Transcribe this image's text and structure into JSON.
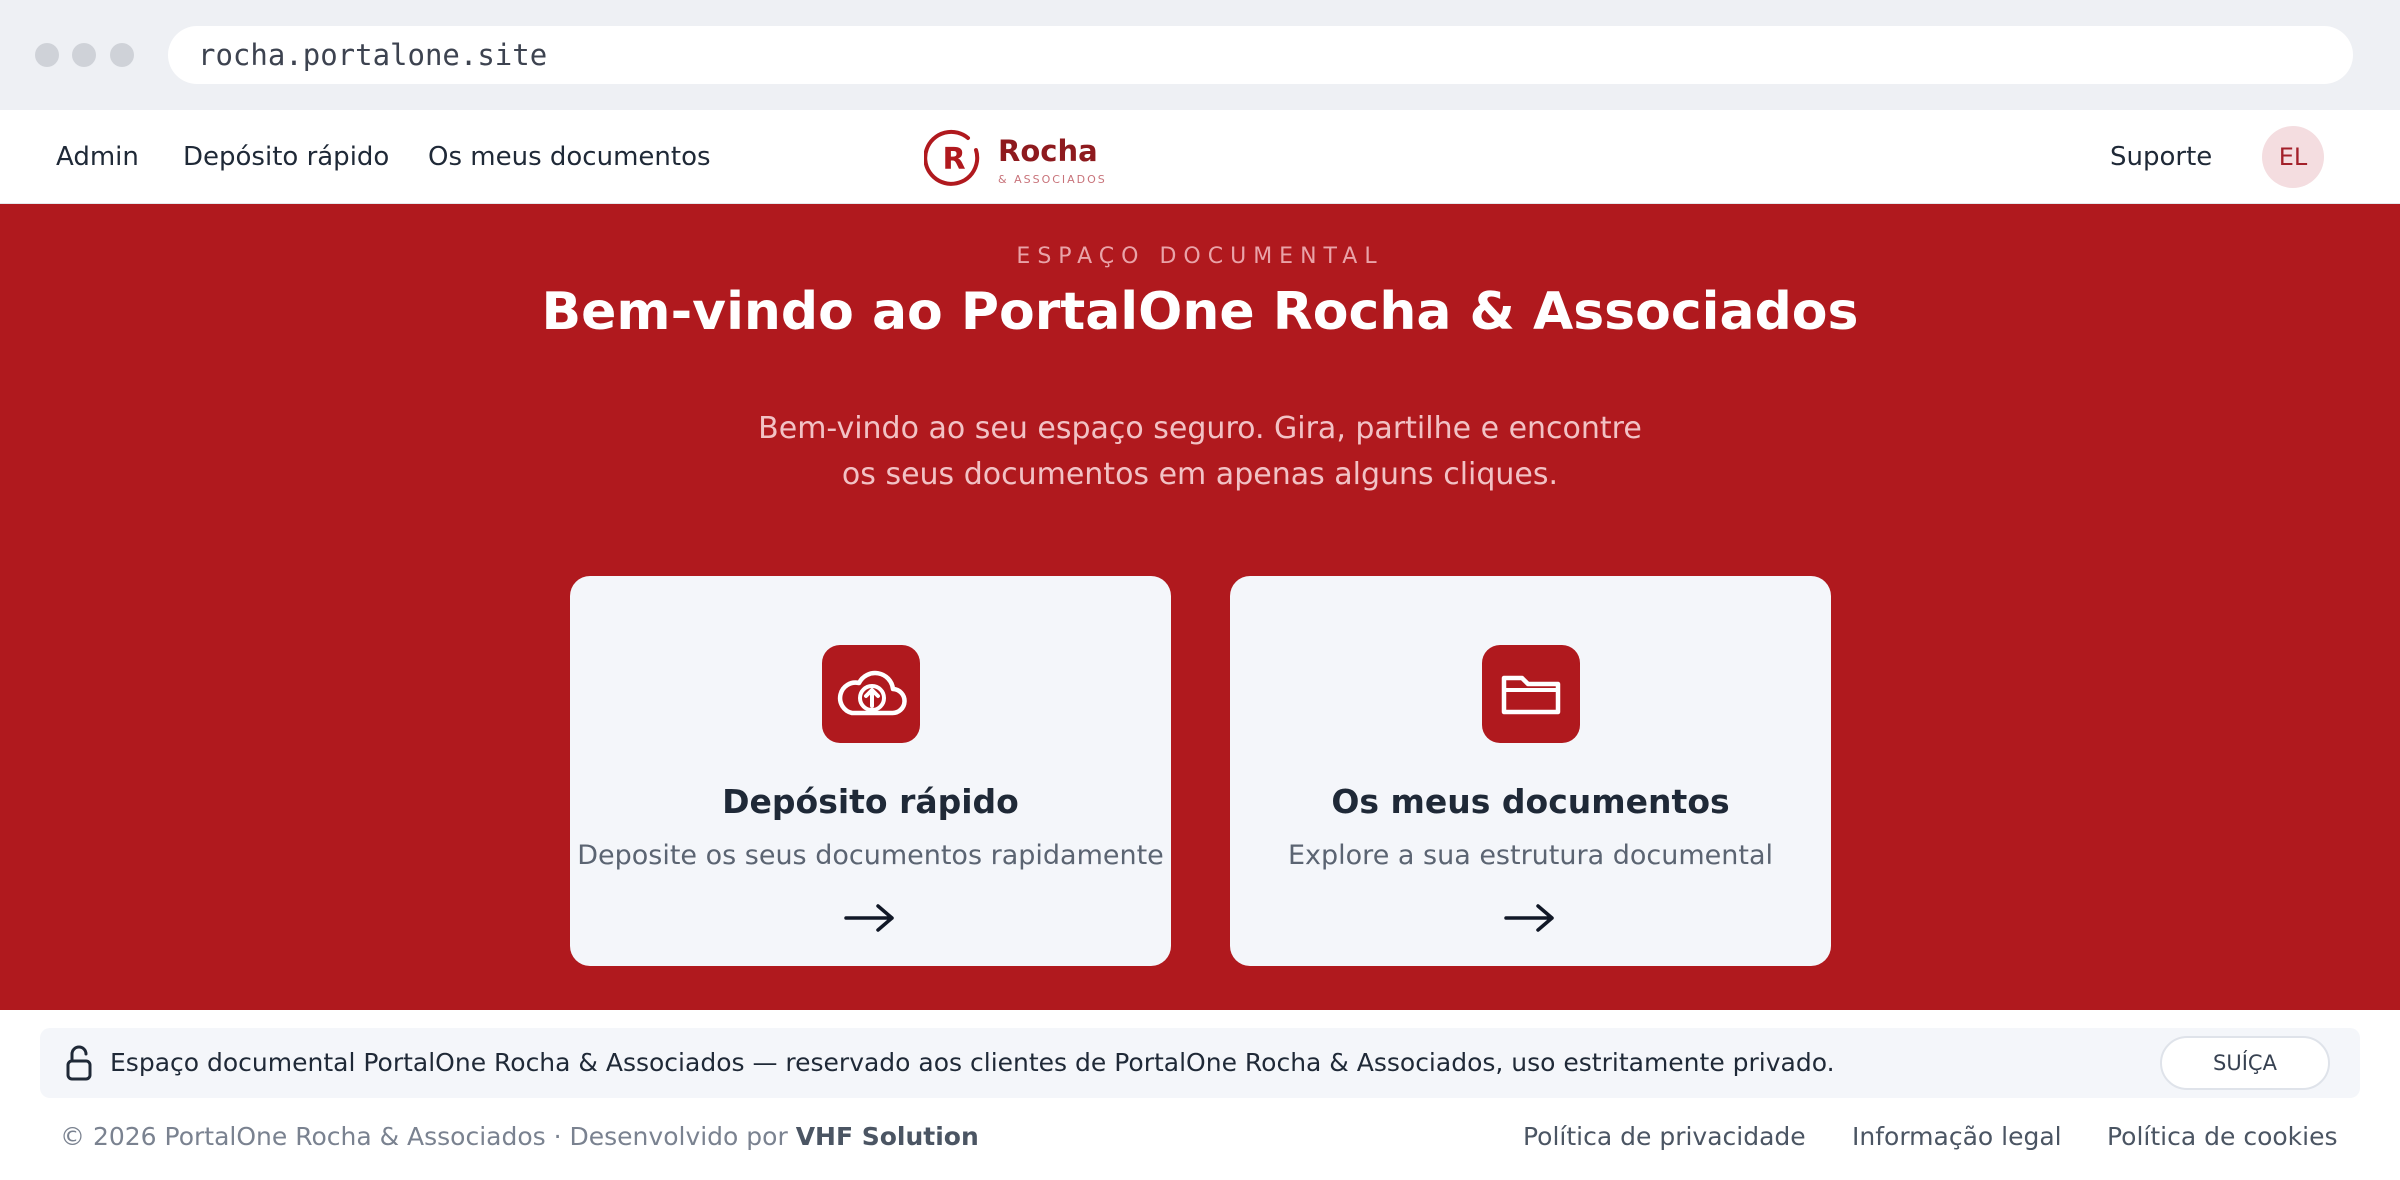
{
  "browser": {
    "url": "rocha.portalone.site"
  },
  "nav": {
    "links": [
      "Admin",
      "Depósito rápido",
      "Os meus documentos"
    ],
    "logo": {
      "name": "Rocha",
      "sub": "& ASSOCIADOS",
      "mark": "R"
    },
    "support": "Suporte",
    "avatar_initials": "EL"
  },
  "hero": {
    "eyebrow": "ESPAÇO DOCUMENTAL",
    "title": "Bem-vindo ao PortalOne Rocha & Associados",
    "subtitle_line1": "Bem-vindo ao seu espaço seguro. Gira, partilhe e encontre",
    "subtitle_line2": "os seus documentos em apenas alguns cliques."
  },
  "cards": [
    {
      "title": "Depósito rápido",
      "desc": "Deposite os seus documentos rapidamente",
      "icon": "cloud-upload-icon"
    },
    {
      "title": "Os meus documentos",
      "desc": "Explore a sua estrutura documental",
      "icon": "folder-icon"
    }
  ],
  "notice": {
    "text": "Espaço documental PortalOne Rocha & Associados — reservado aos clientes de PortalOne Rocha & Associados, uso estritamente privado.",
    "region": "SUÍÇA"
  },
  "footer": {
    "copyright": "© 2026 PortalOne Rocha & Associados · Desenvolvido por",
    "developer": "VHF Solution",
    "links": [
      "Política de privacidade",
      "Informação legal",
      "Política de cookies"
    ]
  },
  "colors": {
    "brand": "#b0191e",
    "card_bg": "#f4f6fa"
  }
}
